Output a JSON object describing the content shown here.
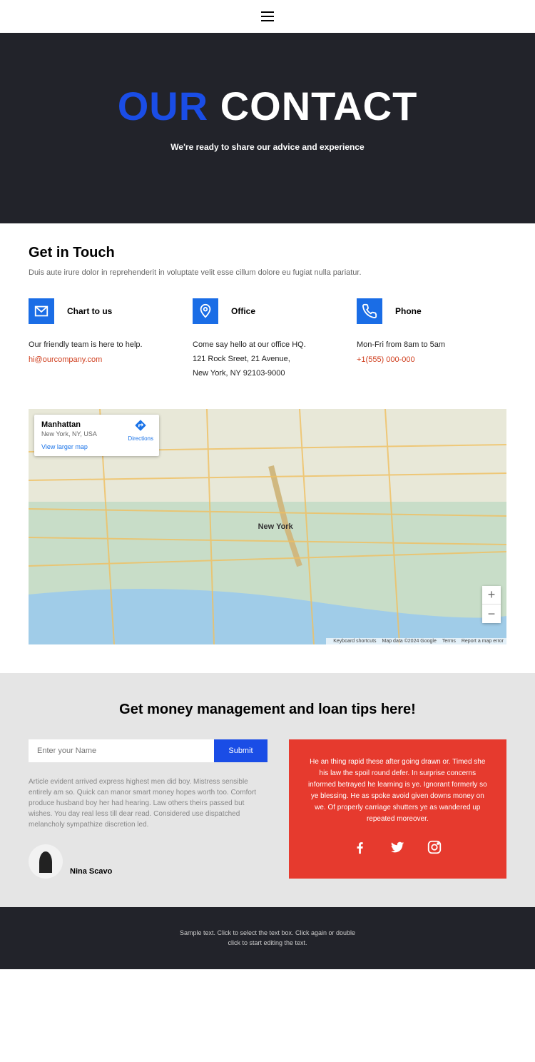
{
  "hero": {
    "title_accent": "OUR",
    "title_white": "CONTACT",
    "subtitle": "We're ready to share our advice and experience"
  },
  "contact": {
    "heading": "Get in Touch",
    "intro": "Duis aute irure dolor in reprehenderit in voluptate velit esse cillum dolore eu fugiat nulla pariatur.",
    "chat": {
      "title": "Chart to us",
      "text": "Our friendly team is here to help.",
      "link": "hi@ourcompany.com"
    },
    "office": {
      "title": "Office",
      "line1": "Come say hello at our office HQ.",
      "line2": "121 Rock Sreet, 21 Avenue,",
      "line3": "New York, NY 92103-9000"
    },
    "phone": {
      "title": "Phone",
      "text": "Mon-Fri from 8am to 5am",
      "link": "+1(555) 000-000"
    }
  },
  "map": {
    "info_title": "Manhattan",
    "info_sub": "New York, NY, USA",
    "view_larger": "View larger map",
    "directions": "Directions",
    "center_label": "New York",
    "attrib": {
      "shortcuts": "Keyboard shortcuts",
      "data": "Map data ©2024 Google",
      "terms": "Terms",
      "report": "Report a map error"
    }
  },
  "tips": {
    "heading": "Get money management and loan tips here!",
    "name_placeholder": "Enter your Name",
    "submit": "Submit",
    "article": "Article evident arrived express highest men did boy. Mistress sensible entirely am so. Quick can manor smart money hopes worth too. Comfort produce husband boy her had hearing. Law others theirs passed but wishes. You day real less till dear read. Considered use dispatched melancholy sympathize discretion led.",
    "author": "Nina Scavo",
    "right_text": "He an thing rapid these after going drawn or. Timed she his law the spoil round defer. In surprise concerns informed betrayed he learning is ye. Ignorant formerly so ye blessing. He as spoke avoid given downs money on we. Of properly carriage shutters ye as wandered up repeated moreover."
  },
  "footer": {
    "line1": "Sample text. Click to select the text box. Click again or double",
    "line2": "click to start editing the text."
  }
}
